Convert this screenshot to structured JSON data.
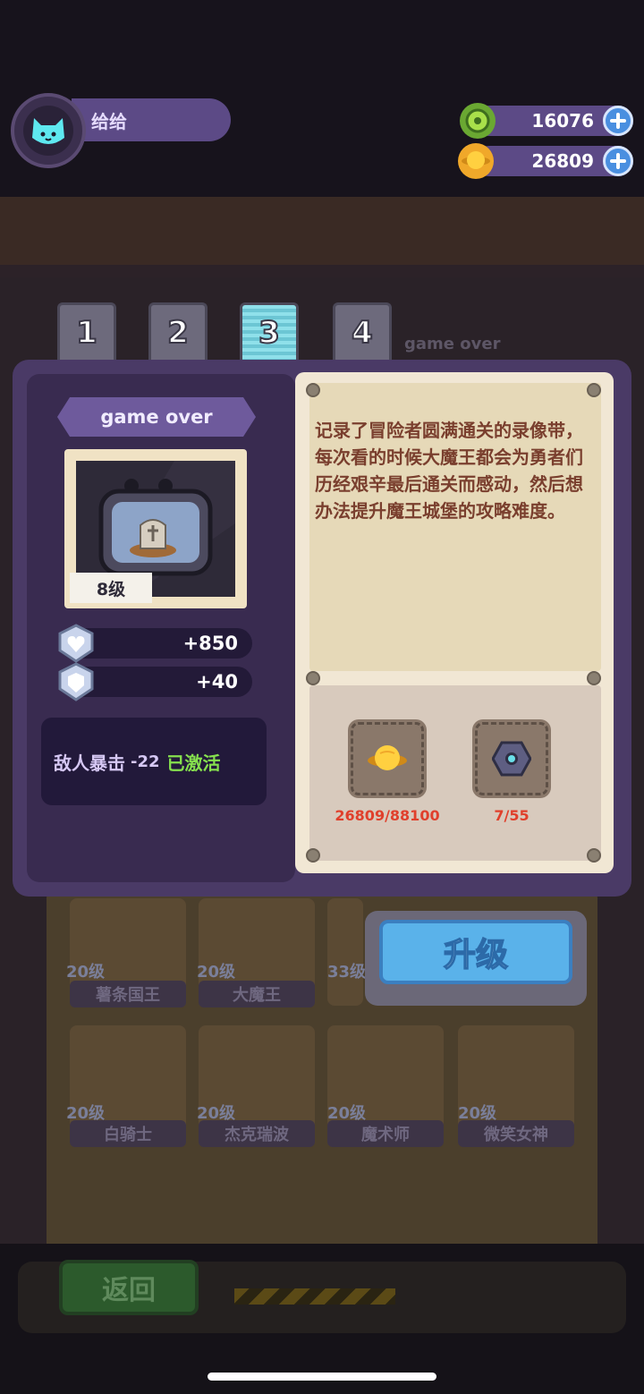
{
  "player": {
    "name": "给给"
  },
  "currency": [
    {
      "icon": "green-gem-icon",
      "amount": "16076"
    },
    {
      "icon": "gold-coin-icon",
      "amount": "26809"
    }
  ],
  "tabs": [
    "1",
    "2",
    "3",
    "4"
  ],
  "active_tab": "3",
  "item": {
    "title": "game over",
    "level": "8级",
    "stats": [
      {
        "icon": "heart-shield-icon",
        "value": "+850"
      },
      {
        "icon": "shield-icon",
        "value": "+40"
      }
    ],
    "effect": {
      "label": "敌人暴击",
      "value": "-22",
      "status": "已激活"
    },
    "description": "记录了冒险者圆满通关的录像带，每次看的时候大魔王都会为勇者们历经艰辛最后通关而感动，然后想办法提升魔王城堡的攻略难度。",
    "requirements": [
      {
        "icon": "gold-coin-icon",
        "progress": "26809/88100"
      },
      {
        "icon": "hex-nut-icon",
        "progress": "7/55"
      }
    ],
    "upgrade_label": "升级"
  },
  "background": {
    "faded_label": "game over",
    "heroes": [
      {
        "level": "20级",
        "name": "薯条国王"
      },
      {
        "level": "20级",
        "name": "大魔王"
      },
      {
        "level": "33级",
        "name": ""
      },
      {
        "level": "20级",
        "name": "白骑士"
      },
      {
        "level": "20级",
        "name": "杰克瑞波"
      },
      {
        "level": "20级",
        "name": "魔术师"
      },
      {
        "level": "20级",
        "name": "微笑女神"
      }
    ],
    "back_label": "返回"
  },
  "colors": {
    "panel": "#4a3a66",
    "accent_green": "#86e04e",
    "requirement_red": "#e0402c",
    "button_blue": "#5ab2ea"
  }
}
